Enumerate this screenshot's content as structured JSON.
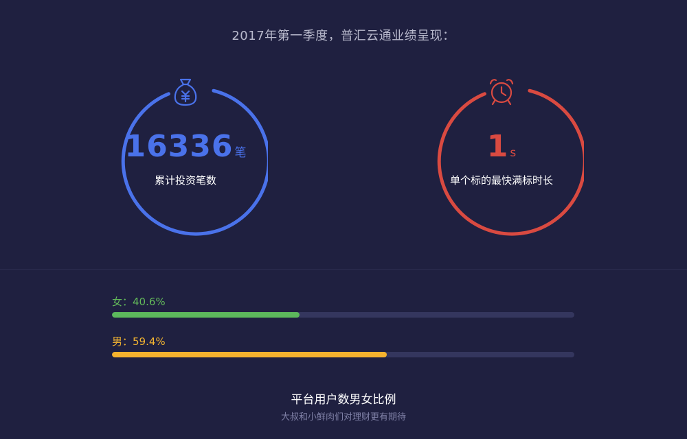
{
  "headline": "2017年第一季度，普汇云通业绩呈现：",
  "stats": [
    {
      "value": "16336",
      "unit": "笔",
      "label": "累计投资笔数",
      "color": "#4a72ea",
      "icon": "money-bag-icon"
    },
    {
      "value": "1",
      "unit": "s",
      "label": "单个标的最快满标时长",
      "color": "#d94a41",
      "icon": "alarm-clock-icon"
    }
  ],
  "gender": {
    "female": {
      "label": "女：40.6%",
      "percent": 40.6,
      "color": "#5cb85c"
    },
    "male": {
      "label": "男：59.4%",
      "percent": 59.4,
      "color": "#f5b22e"
    }
  },
  "footer": {
    "title": "平台用户数男女比例",
    "subtitle": "大叔和小鲜肉们对理财更有期待"
  }
}
